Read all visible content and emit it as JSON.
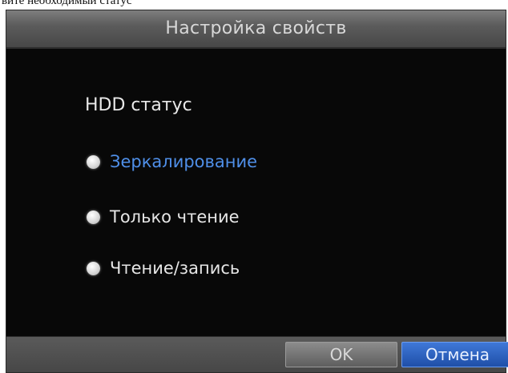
{
  "caption": "вите необходимый статус",
  "dialog": {
    "title": "Настройка свойств",
    "heading": "HDD статус",
    "options": [
      {
        "label": "Зеркалирование",
        "selected": true
      },
      {
        "label": "Только чтение",
        "selected": false
      },
      {
        "label": "Чтение/запись",
        "selected": false
      }
    ],
    "ok_label": "OK",
    "cancel_label": "Отмена"
  },
  "colors": {
    "background": "#080808",
    "selected_text": "#4f8fe8",
    "cancel_button": "#2a62c4"
  }
}
